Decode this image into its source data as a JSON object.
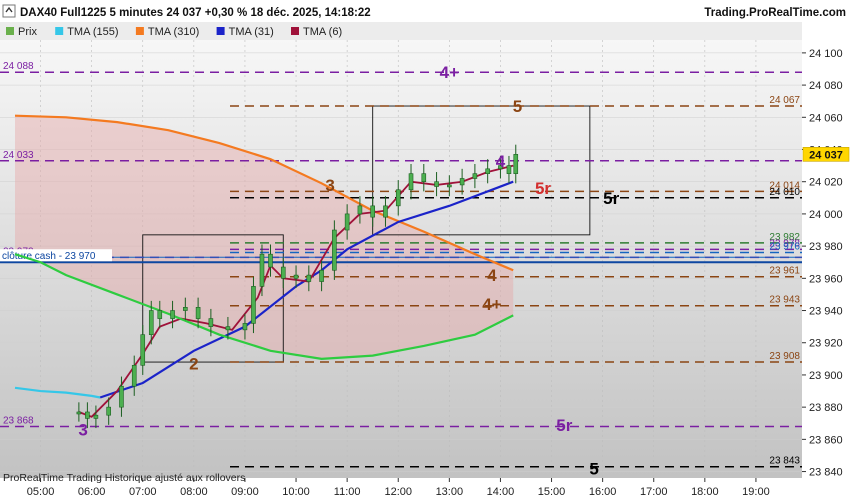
{
  "header": {
    "title": "DAX40 Full1225 5 minutes 24 037 +0,30 % 18 déc. 2025, 14:18:22",
    "site": "Trading.ProRealTime.com"
  },
  "legend": [
    {
      "label": "Prix",
      "color": "#6ab04c"
    },
    {
      "label": "TMA (155)",
      "color": "#35c7e8"
    },
    {
      "label": "TMA (310)",
      "color": "#f47a20"
    },
    {
      "label": "TMA (31)",
      "color": "#1b23c9"
    },
    {
      "label": "TMA (6)",
      "color": "#a0123a"
    }
  ],
  "footer": "ProRealTime Trading  Historique ajusté aux rollovers",
  "chart_data": {
    "type": "line",
    "title": "DAX40 Full1225 5 minutes",
    "x_labels": [
      "05:00",
      "06:00",
      "07:00",
      "08:00",
      "09:00",
      "10:00",
      "11:00",
      "12:00",
      "13:00",
      "14:00",
      "15:00",
      "16:00",
      "17:00",
      "18:00",
      "19:00"
    ],
    "xlim": [
      "04:30",
      "19:40"
    ],
    "y_ticks": [
      23840,
      23860,
      23880,
      23900,
      23920,
      23940,
      23960,
      23980,
      24000,
      24020,
      24040,
      24060,
      24080,
      24100
    ],
    "ylim": [
      23836,
      24108
    ],
    "last_price": "24 037",
    "last_price_value": 24037,
    "levels": [
      {
        "label": "24 088",
        "value": 24088,
        "color": "#7b1fa2",
        "side": "left"
      },
      {
        "label": "24 067",
        "value": 24067,
        "color": "#8b4513",
        "side": "right"
      },
      {
        "label": "24 033",
        "value": 24033,
        "color": "#7b1fa2",
        "side": "left"
      },
      {
        "label": "24 014",
        "value": 24014,
        "color": "#8b4513",
        "side": "right"
      },
      {
        "label": "24 010",
        "value": 24010,
        "color": "#000000",
        "side": "right"
      },
      {
        "label": "23 982",
        "value": 23982,
        "color": "#2e7d32",
        "side": "right"
      },
      {
        "label": "23 978",
        "value": 23978,
        "color": "#7b1fa2",
        "side": "right"
      },
      {
        "label": "23 976",
        "value": 23976,
        "color": "#1565c0",
        "side": "right"
      },
      {
        "label": "23 973",
        "value": 23973,
        "color": "#7b1fa2",
        "side": "left"
      },
      {
        "label": "23 961",
        "value": 23961,
        "color": "#8b4513",
        "side": "right"
      },
      {
        "label": "23 943",
        "value": 23943,
        "color": "#8b4513",
        "side": "right"
      },
      {
        "label": "23 908",
        "value": 23908,
        "color": "#8b4513",
        "side": "right"
      },
      {
        "label": "23 868",
        "value": 23868,
        "color": "#7b1fa2",
        "side": "left"
      },
      {
        "label": "23 843",
        "value": 23843,
        "color": "#000000",
        "side": "right"
      }
    ],
    "cloture_cash": {
      "label": "clôture cash -  23 970",
      "value": 23970
    },
    "annotations": [
      {
        "text": "4+",
        "t": "13:00",
        "y": 24088,
        "color": "#7b1fa2"
      },
      {
        "text": "5",
        "t": "14:20",
        "y": 24067,
        "color": "#8b4513"
      },
      {
        "text": "4",
        "t": "14:00",
        "y": 24033,
        "color": "#7b1fa2"
      },
      {
        "text": "5r",
        "t": "14:50",
        "y": 24016,
        "color": "#d32f2f"
      },
      {
        "text": "5r",
        "t": "16:10",
        "y": 24010,
        "color": "#000000"
      },
      {
        "text": "3",
        "t": "10:40",
        "y": 24018,
        "color": "#8b4513"
      },
      {
        "text": "4",
        "t": "13:50",
        "y": 23962,
        "color": "#8b4513"
      },
      {
        "text": "4+",
        "t": "13:50",
        "y": 23944,
        "color": "#8b4513"
      },
      {
        "text": "2",
        "t": "08:00",
        "y": 23907,
        "color": "#8b4513"
      },
      {
        "text": "3",
        "t": "05:50",
        "y": 23866,
        "color": "#7b1fa2"
      },
      {
        "text": "5r",
        "t": "15:15",
        "y": 23869,
        "color": "#7b1fa2"
      },
      {
        "text": "5",
        "t": "15:50",
        "y": 23842,
        "color": "#000000"
      }
    ],
    "boxes": [
      {
        "t0": "07:00",
        "t1": "09:45",
        "y0": 23908,
        "y1": 23987
      },
      {
        "t0": "11:30",
        "t1": "15:45",
        "y0": 23987,
        "y1": 24067
      }
    ],
    "price": [
      [
        "05:45",
        23877
      ],
      [
        "05:55",
        23873
      ],
      [
        "06:05",
        23875
      ],
      [
        "06:20",
        23880
      ],
      [
        "06:35",
        23893
      ],
      [
        "06:50",
        23906
      ],
      [
        "07:00",
        23925
      ],
      [
        "07:10",
        23940
      ],
      [
        "07:20",
        23935
      ],
      [
        "07:35",
        23940
      ],
      [
        "07:50",
        23942
      ],
      [
        "08:05",
        23935
      ],
      [
        "08:20",
        23930
      ],
      [
        "08:40",
        23928
      ],
      [
        "09:00",
        23932
      ],
      [
        "09:10",
        23955
      ],
      [
        "09:20",
        23975
      ],
      [
        "09:30",
        23967
      ],
      [
        "09:45",
        23960
      ],
      [
        "10:00",
        23962
      ],
      [
        "10:15",
        23958
      ],
      [
        "10:30",
        23965
      ],
      [
        "10:45",
        23990
      ],
      [
        "11:00",
        24000
      ],
      [
        "11:15",
        24005
      ],
      [
        "11:30",
        23998
      ],
      [
        "11:45",
        24005
      ],
      [
        "12:00",
        24015
      ],
      [
        "12:15",
        24025
      ],
      [
        "12:30",
        24020
      ],
      [
        "12:45",
        24017
      ],
      [
        "13:00",
        24018
      ],
      [
        "13:15",
        24022
      ],
      [
        "13:30",
        24025
      ],
      [
        "13:45",
        24028
      ],
      [
        "14:00",
        24030
      ],
      [
        "14:10",
        24025
      ],
      [
        "14:18",
        24037
      ]
    ],
    "series": [
      {
        "name": "TMA (155)",
        "color": "#35c7e8",
        "points": [
          [
            "04:30",
            23892
          ],
          [
            "05:00",
            23890
          ],
          [
            "05:30",
            23889
          ],
          [
            "06:00",
            23887
          ],
          [
            "06:10",
            23886
          ]
        ]
      },
      {
        "name": "TMA (310)",
        "color": "#f47a20",
        "points": [
          [
            "04:30",
            24061
          ],
          [
            "05:30",
            24060
          ],
          [
            "06:30",
            24057
          ],
          [
            "07:30",
            24052
          ],
          [
            "08:30",
            24044
          ],
          [
            "09:30",
            24034
          ],
          [
            "10:30",
            24019
          ],
          [
            "11:30",
            24002
          ],
          [
            "12:30",
            23989
          ],
          [
            "13:30",
            23975
          ],
          [
            "14:15",
            23965
          ]
        ]
      },
      {
        "name": "TMA (31)",
        "color": "#1b23c9",
        "points": [
          [
            "06:10",
            23886
          ],
          [
            "07:00",
            23895
          ],
          [
            "08:00",
            23915
          ],
          [
            "09:00",
            23930
          ],
          [
            "10:00",
            23955
          ],
          [
            "10:30",
            23965
          ],
          [
            "11:00",
            23978
          ],
          [
            "12:00",
            23995
          ],
          [
            "13:00",
            24005
          ],
          [
            "14:00",
            24017
          ],
          [
            "14:15",
            24020
          ]
        ]
      },
      {
        "name": "TMA (6)",
        "color": "#a0123a",
        "points": [
          [
            "05:45",
            23877
          ],
          [
            "06:00",
            23874
          ],
          [
            "06:30",
            23890
          ],
          [
            "07:00",
            23913
          ],
          [
            "07:20",
            23930
          ],
          [
            "07:45",
            23935
          ],
          [
            "08:15",
            23932
          ],
          [
            "08:45",
            23928
          ],
          [
            "09:15",
            23948
          ],
          [
            "09:30",
            23968
          ],
          [
            "09:45",
            23960
          ],
          [
            "10:15",
            23958
          ],
          [
            "10:45",
            23985
          ],
          [
            "11:15",
            24000
          ],
          [
            "11:45",
            24002
          ],
          [
            "12:15",
            24020
          ],
          [
            "12:45",
            24018
          ],
          [
            "13:15",
            24020
          ],
          [
            "13:45",
            24026
          ],
          [
            "14:15",
            24030
          ]
        ]
      },
      {
        "name": "green",
        "color": "#2ecc40",
        "points": [
          [
            "04:30",
            23975
          ],
          [
            "05:00",
            23970
          ],
          [
            "05:30",
            23962
          ],
          [
            "06:30",
            23950
          ],
          [
            "07:30",
            23938
          ],
          [
            "08:30",
            23925
          ],
          [
            "09:30",
            23915
          ],
          [
            "10:30",
            23910
          ],
          [
            "11:30",
            23912
          ],
          [
            "12:30",
            23918
          ],
          [
            "13:30",
            23925
          ],
          [
            "14:15",
            23937
          ]
        ]
      }
    ]
  }
}
